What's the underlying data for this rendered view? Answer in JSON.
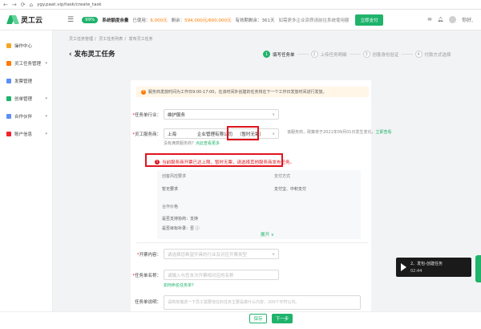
{
  "browser": {
    "url": "ygy.paat.vip/task/create_task"
  },
  "header": {
    "logo_text": "灵工云",
    "percent": "99%",
    "quota_label": "系统额度余量",
    "used_label": "已使用：",
    "used_value": "6,000元",
    "remain_label": "剩余：",
    "remain_value": "594,000元/600,000元",
    "valid_label": "有效期剩余：",
    "valid_value": "361天",
    "note": "如需更多企业资质请前往系统使用额",
    "pay_button": "立即支付",
    "user_name": "你好,"
  },
  "sidebar": {
    "items": [
      {
        "label": "操作中心",
        "color": "#f5a623"
      },
      {
        "label": "灵工任务管理",
        "color": "#ff7a00"
      },
      {
        "label": "发票管理",
        "color": "#5b8ff9"
      },
      {
        "label": "创单管理",
        "color": "#1fb36b"
      },
      {
        "label": "合作伙伴",
        "color": "#5b8ff9"
      },
      {
        "label": "账户信息",
        "color": "#f5222d"
      }
    ]
  },
  "breadcrumb": {
    "items": [
      "灵工任务管理",
      "灵工任务列表",
      "发布灵工任务"
    ]
  },
  "page": {
    "title": "发布灵工任务"
  },
  "steps": [
    {
      "num": "1",
      "label": "填写任务单"
    },
    {
      "num": "2",
      "label": "上传任务明细"
    },
    {
      "num": "3",
      "label": "创客身份验证"
    },
    {
      "num": "4",
      "label": "付款方式选择"
    }
  ],
  "notice": "服务商发放时间为工作日9:00-17:00，在该时间外创建的任务将在下一个工作日发放时间进行发放。",
  "form": {
    "industry_label": "任务单行业：",
    "industry_value": "维护服务",
    "provider_label": "灵工服务商：",
    "provider_value": "上海",
    "provider_company": "企业管理有限公司",
    "provider_tag": "（暂时无票）",
    "provider_note": "该服务商，政策将于2021年09月01日发生变化，",
    "provider_note_link": "立即查看",
    "no_provider_text": "没有满意服务商？",
    "no_provider_link": "点此查看更多",
    "error_text": "当前服务商开票已达上限，暂时无票，请选择其他服务商发布任务。",
    "panel": {
      "req_title": "创客风控要求",
      "req_value": "暂无要求",
      "pay_title": "支付方式",
      "pay_value": "支付宝、中积支付",
      "coop_title": "合作价格",
      "support_label": "是否支持协商：",
      "support_value": "支持",
      "sign_label": "是否目标补录：",
      "sign_value": "否"
    },
    "expand_label": "展开 ∨",
    "invoice_label": "开票内容：",
    "invoice_placeholder": "请选择您希望开具的行业及对应开票类型",
    "name_label": "任务单名称：",
    "name_placeholder": "请输入与您本次开票相对应的名称",
    "name_link": "如何命名任务单?",
    "desc_label": "任务单说明：",
    "desc_placeholder": "请简单描述一下员工需要他在的任务主要是做什么内容，200个字符以内。"
  },
  "footer": {
    "save_label": "保存",
    "next_label": "下一步"
  },
  "video": {
    "title": "2、发包-创建任务",
    "time": "02:44"
  }
}
